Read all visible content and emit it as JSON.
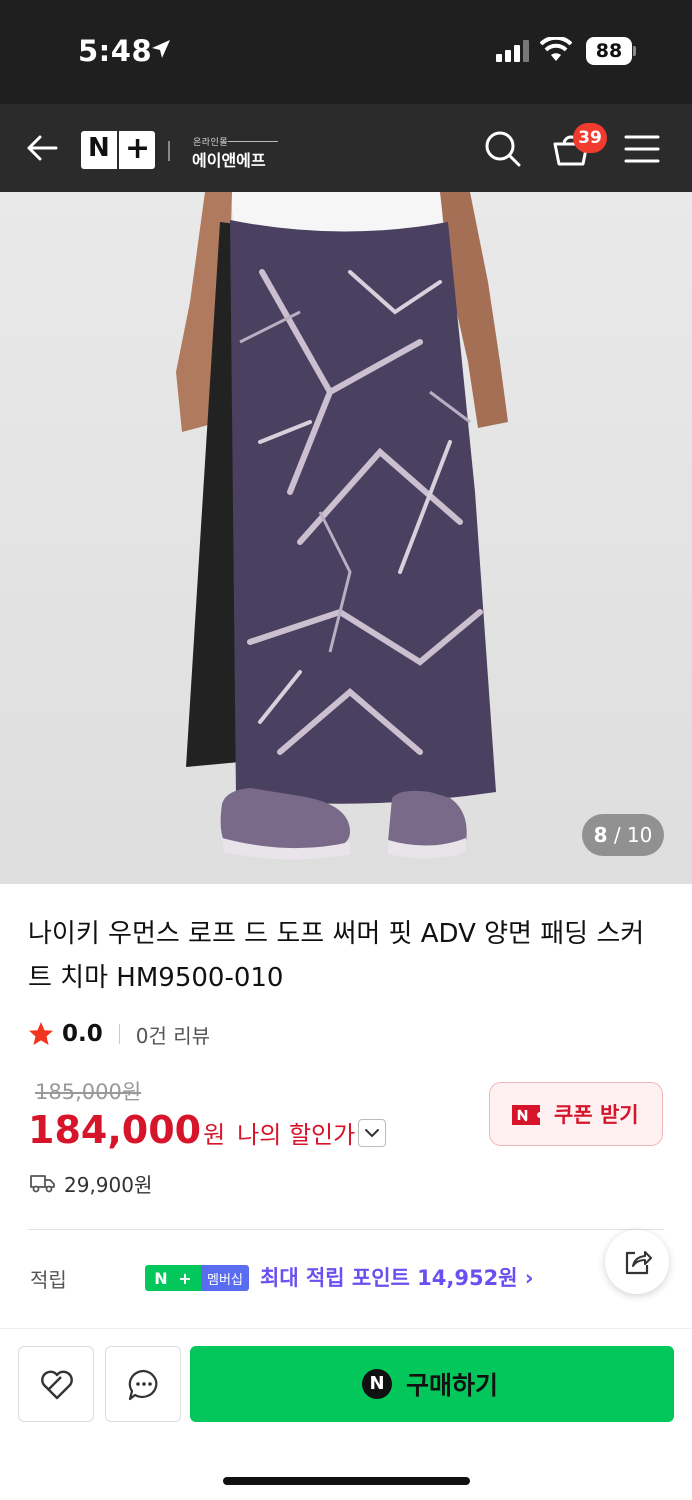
{
  "status_bar": {
    "time": "5:48",
    "battery": "88"
  },
  "header": {
    "logo_n": "N",
    "logo_plus": "+",
    "brand_small": "온라인몰",
    "brand": "에이앤에프",
    "cart_count": "39"
  },
  "gallery": {
    "current": "8",
    "separator": " / ",
    "total": "10"
  },
  "product": {
    "title": "나이키 우먼스 로프 드 도프 써머 핏 ADV 양면 패딩 스커트 치마 HM9500-010",
    "rating": "0.0",
    "review_count": "0건 리뷰",
    "original_price": "185,000원",
    "price": "184,000",
    "currency": "원",
    "my_discount_label": "나의 할인가",
    "coupon_label": "쿠폰 받기",
    "shipping_fee": "29,900원"
  },
  "points": {
    "label": "적립",
    "badge_n": "N",
    "badge_plus": "+",
    "badge_membership": "멤버십",
    "text": "최대 적립 포인트 14,952원 ›"
  },
  "bottom": {
    "buy_icon": "N",
    "buy_label": "구매하기"
  },
  "colors": {
    "accent_red": "#d6152b",
    "naver_green": "#03c75a",
    "points_purple": "#6b4ff0",
    "header_bg": "#2b2b2b"
  }
}
